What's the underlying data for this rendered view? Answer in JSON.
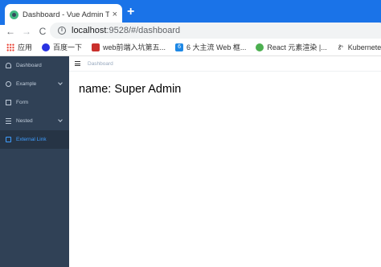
{
  "browser": {
    "tab": {
      "title": "Dashboard - Vue Admin Temp",
      "close": "×"
    },
    "new_tab": "+",
    "nav": {
      "back": "←",
      "forward": "→",
      "reload": "C"
    },
    "address": {
      "info_glyph": "i",
      "host": "localhost",
      "path": ":9528/#/dashboard"
    },
    "bookmarks": [
      {
        "label": "应用",
        "icon": "apps-grid-icon"
      },
      {
        "label": "百度一下",
        "icon": "baidu-paw-icon"
      },
      {
        "label": "web前端入坑第五...",
        "icon": "csdn-icon"
      },
      {
        "label": "6 大主流 Web 框...",
        "icon": "six-icon",
        "glyph": "6"
      },
      {
        "label": "React 元素渲染 |...",
        "icon": "react-icon"
      },
      {
        "label": "Kubernetes部署Ka...",
        "icon": "k8s-icon",
        "glyph": "Ꮡ"
      }
    ]
  },
  "sidebar": {
    "items": [
      {
        "label": "Dashboard",
        "icon": "dashboard-icon"
      },
      {
        "label": "Example",
        "icon": "example-icon",
        "expandable": true
      },
      {
        "label": "Form",
        "icon": "form-icon"
      },
      {
        "label": "Nested",
        "icon": "nested-icon",
        "expandable": true
      },
      {
        "label": "External Link",
        "icon": "external-link-icon",
        "active": true
      }
    ]
  },
  "navbar": {
    "breadcrumb": "Dashboard"
  },
  "main": {
    "text": "name: Super Admin"
  },
  "colors": {
    "browser_accent": "#1a73e8",
    "sidebar_bg": "#304156",
    "sidebar_text": "#bfcbd9",
    "sidebar_active": "#409eff",
    "breadcrumb": "#97a8be"
  }
}
